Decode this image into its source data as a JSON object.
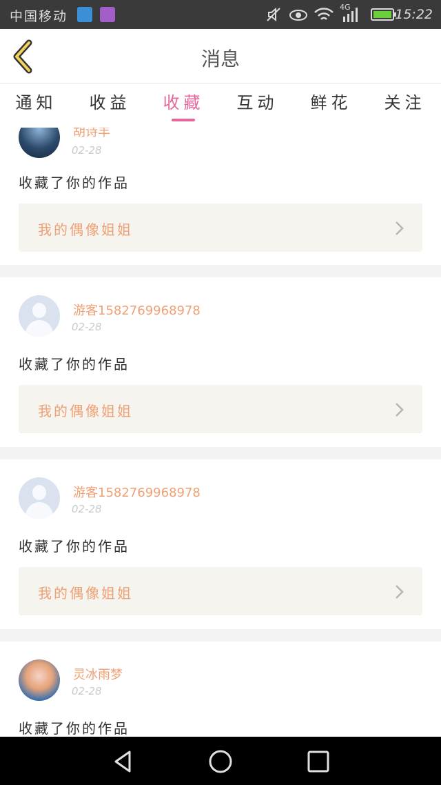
{
  "status_bar": {
    "carrier": "中国移动",
    "network": "4G",
    "time": "15:22",
    "icons": [
      "telegram-app-icon",
      "gallery-app-icon",
      "mute-icon",
      "eye-icon",
      "wifi-icon",
      "signal-icon",
      "battery-charging-icon"
    ]
  },
  "header": {
    "title": "消息",
    "back_icon": "chevron-left-icon"
  },
  "tabs": [
    {
      "label": "通知",
      "active": false
    },
    {
      "label": "收益",
      "active": false
    },
    {
      "label": "收藏",
      "active": true
    },
    {
      "label": "互动",
      "active": false
    },
    {
      "label": "鲜花",
      "active": false
    },
    {
      "label": "关注",
      "active": false
    }
  ],
  "colors": {
    "accent": "#e6679b",
    "username": "#f0a074",
    "work_bg": "#f5f4ef"
  },
  "feed": [
    {
      "username": "胡诗丰",
      "date": "02-28",
      "action": "收藏了你的作品",
      "work_title": "我的偶像姐姐",
      "avatar": "photo"
    },
    {
      "username": "游客15827699689​78",
      "date": "02-28",
      "action": "收藏了你的作品",
      "work_title": "我的偶像姐姐",
      "avatar": "default"
    },
    {
      "username": "游客1582769968978",
      "date": "02-28",
      "action": "收藏了你的作品",
      "work_title": "我的偶像姐姐",
      "avatar": "default"
    },
    {
      "username": "灵冰雨梦",
      "date": "02-28",
      "action": "收藏了你的作品",
      "work_title": "",
      "avatar": "photo"
    }
  ],
  "nav_bar": [
    "back-triangle-icon",
    "home-circle-icon",
    "recents-square-icon"
  ]
}
